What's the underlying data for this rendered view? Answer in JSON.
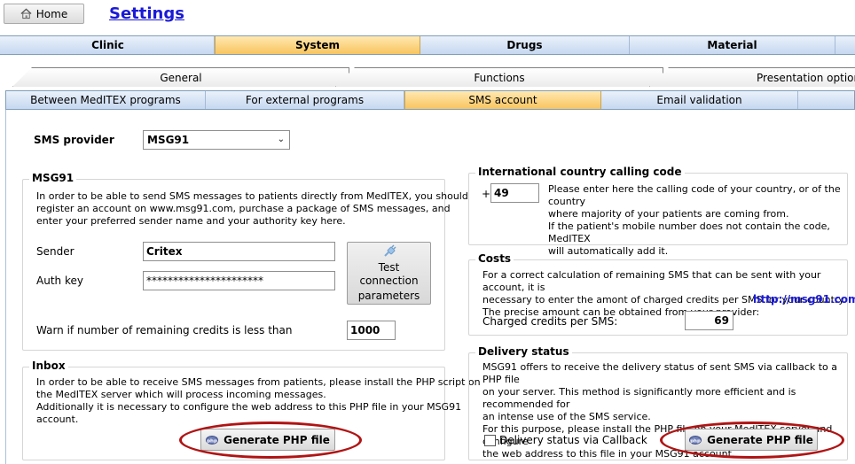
{
  "header": {
    "home_label": "Home",
    "title": "Settings"
  },
  "main_tabs": [
    "Clinic",
    "System",
    "Drugs",
    "Material"
  ],
  "sub_tabs": [
    "General",
    "Functions",
    "Presentation options"
  ],
  "third_tabs": [
    "Between MedITEX programs",
    "For external programs",
    "SMS account",
    "Email validation"
  ],
  "sms_provider": {
    "label": "SMS provider",
    "value": "MSG91"
  },
  "msg91": {
    "title": "MSG91",
    "desc": [
      "In order to be able to send SMS messages to patients directly from MedITEX, you should",
      "register an account on www.msg91.com, purchase a package of SMS messages, and",
      "enter your preferred sender name and your authority key here."
    ],
    "sender_label": "Sender",
    "sender_value": "Critex",
    "auth_label": "Auth key",
    "auth_value": "**********************",
    "test_btn_line1": "Test connection",
    "test_btn_line2": "parameters",
    "warn_label": "Warn if number of remaining credits is less than",
    "warn_value": "1000"
  },
  "inbox": {
    "title": "Inbox",
    "desc": [
      "In order to be able to receive SMS messages from patients, please install the PHP script on",
      "the MedITEX server which will process incoming messages.",
      "Additionally it is necessary to configure the web address to this PHP file in your MSG91",
      "account."
    ],
    "button": "Generate PHP file"
  },
  "calling_code": {
    "title": "International country calling code",
    "plus": "+",
    "value": "49",
    "desc": [
      "Please enter here the calling code of your country, or of the country",
      "where majority of your patients are coming from.",
      "If the patient's mobile number does not contain the code, MedITEX",
      "will automatically add it."
    ]
  },
  "costs": {
    "title": "Costs",
    "desc": [
      "For a correct calculation of remaining SMS that can be sent with your account, it is",
      "necessary to enter the amont of charged credits per SMS for your country.",
      "The precise amount can be obtained from your provider:"
    ],
    "link": "http://msg91.com",
    "charged_label": "Charged credits per SMS:",
    "charged_value": "69"
  },
  "delivery": {
    "title": "Delivery status",
    "desc": [
      "MSG91 offers to receive the delivery status of sent SMS via callback to a PHP file",
      "on your server. This method is significantly more efficient and is recommended for",
      "an intense use of the SMS service.",
      "For this purpose, please install the PHP file on your MedITEX server and configure",
      "the web address to this file in your MSG91 account."
    ],
    "checkbox_label": "Delivery status via Callback",
    "button": "Generate PHP file"
  }
}
